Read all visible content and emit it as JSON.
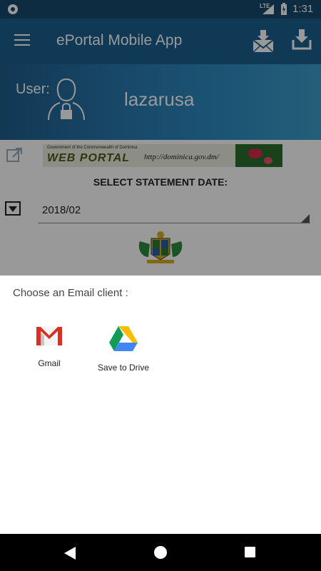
{
  "status_bar": {
    "network": "LTE",
    "time": "1:31"
  },
  "toolbar": {
    "title": "ePortal Mobile App",
    "menu_icon": "hamburger-menu-icon",
    "actions": [
      "email-icon",
      "download-icon"
    ]
  },
  "user": {
    "label": "User:",
    "name": "lazarusa"
  },
  "portal_banner": {
    "header": "Government of the Commonwealth of Dominica",
    "title": "WEB PORTAL",
    "url": "http://dominica.gov.dm/"
  },
  "statement": {
    "label": "SELECT STATEMENT DATE:",
    "selected_date": "2018/02"
  },
  "chooser": {
    "title": "Choose an Email client :",
    "apps": [
      {
        "label": "Gmail",
        "icon": "gmail-icon"
      },
      {
        "label": "Save to Drive",
        "icon": "google-drive-icon"
      }
    ]
  },
  "colors": {
    "toolbar": "#1c5f8e",
    "status_bar": "#174a6f",
    "banner_accent": "#2e8cc2"
  }
}
